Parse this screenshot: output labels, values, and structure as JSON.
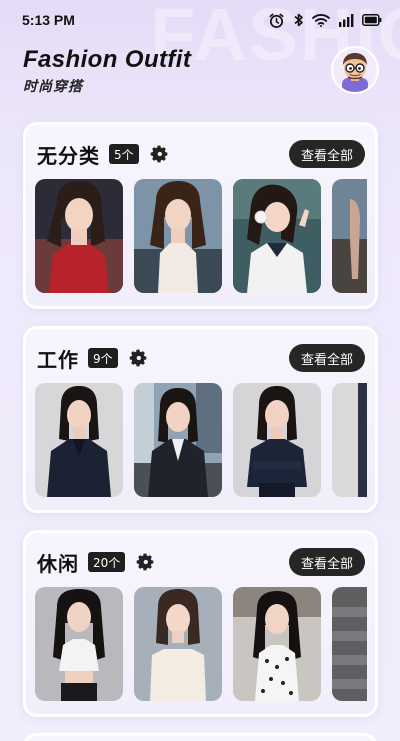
{
  "status_bar": {
    "time": "5:13 PM",
    "icons": [
      "alarm-icon",
      "bluetooth-icon",
      "wifi-icon",
      "signal-icon",
      "battery-icon"
    ]
  },
  "watermark": "FASHION",
  "header": {
    "title": "Fashion Outfit",
    "subtitle": "时尚穿搭"
  },
  "categories": [
    {
      "name": "无分类",
      "count": "5个",
      "view_all": "查看全部",
      "thumbs": [
        "photo-red-sweater",
        "photo-white-camisole",
        "photo-headphones-uniform",
        "photo-rocky-shore"
      ]
    },
    {
      "name": "工作",
      "count": "9个",
      "view_all": "查看全部",
      "thumbs": [
        "photo-navy-blazer",
        "photo-office-suit",
        "photo-navy-suit",
        "photo-partial-suit"
      ]
    },
    {
      "name": "休闲",
      "count": "20个",
      "view_all": "查看全部",
      "thumbs": [
        "photo-white-crop-top",
        "photo-cream-offshoulder",
        "photo-polka-dot-dress",
        "photo-stairs"
      ]
    }
  ],
  "colors": {
    "accent_dark": "#262626",
    "background": "#efeafb",
    "card": "#f5f3fd"
  }
}
